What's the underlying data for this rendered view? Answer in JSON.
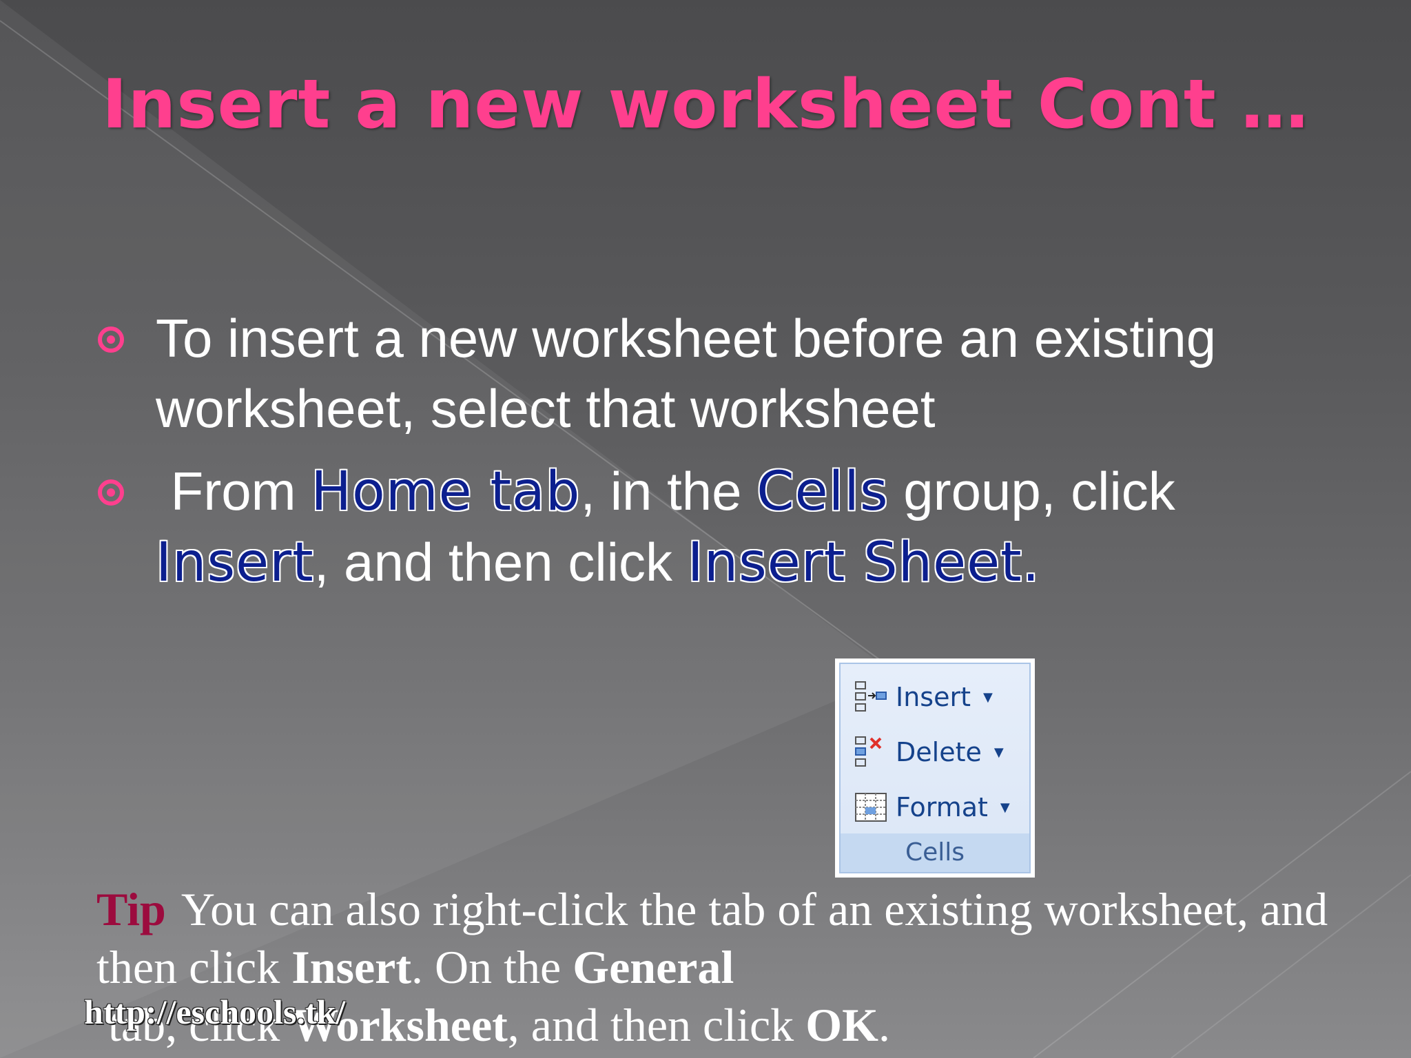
{
  "slide": {
    "title": "Insert a new worksheet Cont …",
    "bullets": [
      {
        "text": "To insert a new worksheet before an existing worksheet, select that worksheet"
      },
      {
        "parts": {
          "p1": " From ",
          "h1": "Home tab",
          "p2": ", in the ",
          "h2": "Cells",
          "p3": " group, click ",
          "h3": "Insert",
          "p4": ", and then click ",
          "h4": "Insert Sheet."
        }
      }
    ],
    "ribbon": {
      "items": [
        {
          "label": "Insert",
          "icon": "insert-cells-icon"
        },
        {
          "label": "Delete",
          "icon": "delete-cells-icon"
        },
        {
          "label": "Format",
          "icon": "format-cells-icon"
        }
      ],
      "group_label": "Cells",
      "dropdown_glyph": "▼"
    },
    "tip": {
      "label": "Tip",
      "t1": "You can also right-click the tab of an existing worksheet, and then click ",
      "b1": "Insert",
      "t2": ". On the ",
      "b2": "General",
      "t3": " tab, click ",
      "b3": "Worksheet",
      "t4": ", and then click ",
      "b4": "OK",
      "t5": "."
    },
    "footer_url": "http://eschools.tk/",
    "colors": {
      "title": "#ff3f8e",
      "highlight": "#0c1f8f",
      "tip_label": "#9c0b3e"
    }
  }
}
